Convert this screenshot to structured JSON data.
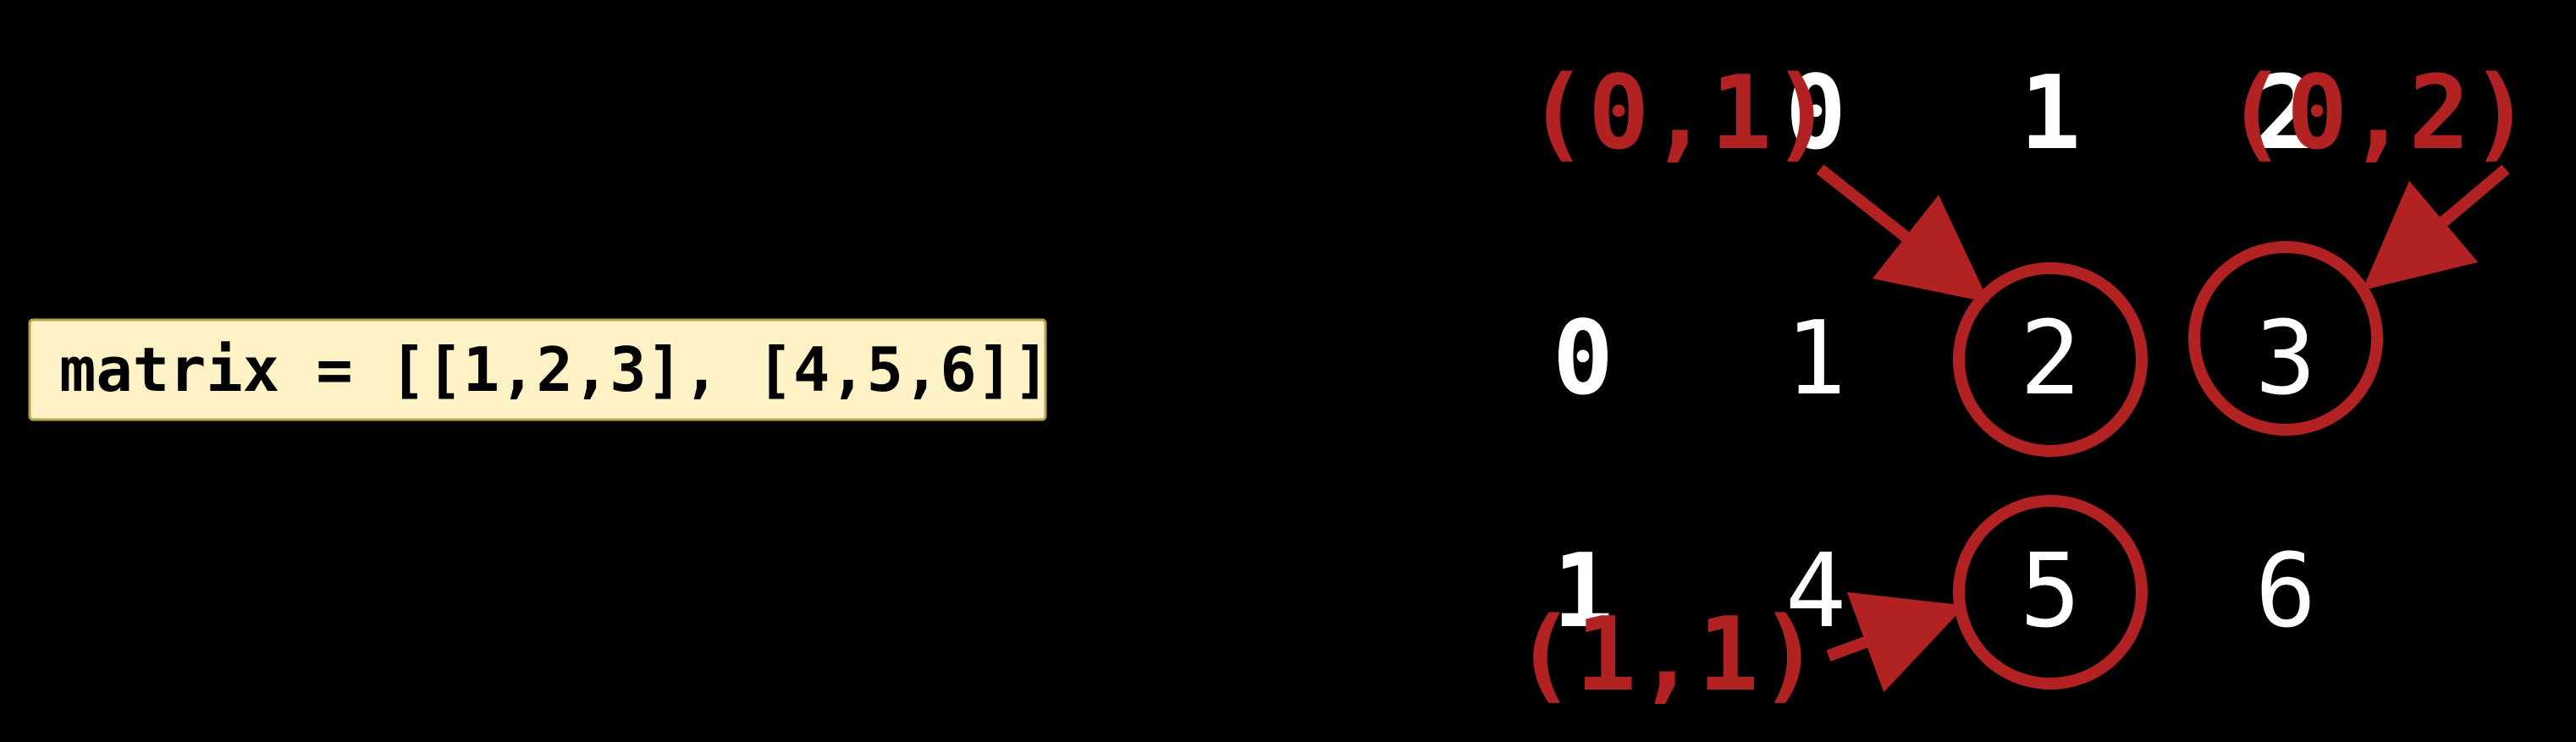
{
  "code": {
    "line": "matrix = [[1,2,3], [4,5,6]]"
  },
  "grid": {
    "col_headers": [
      "0",
      "1",
      "2"
    ],
    "rows": [
      {
        "label": "0",
        "cells": [
          "1",
          "2",
          "3"
        ]
      },
      {
        "label": "1",
        "cells": [
          "4",
          "5",
          "6"
        ]
      }
    ]
  },
  "annotations": {
    "a": "(0,1)",
    "b": "(0,2)",
    "c": "(1,1)"
  }
}
